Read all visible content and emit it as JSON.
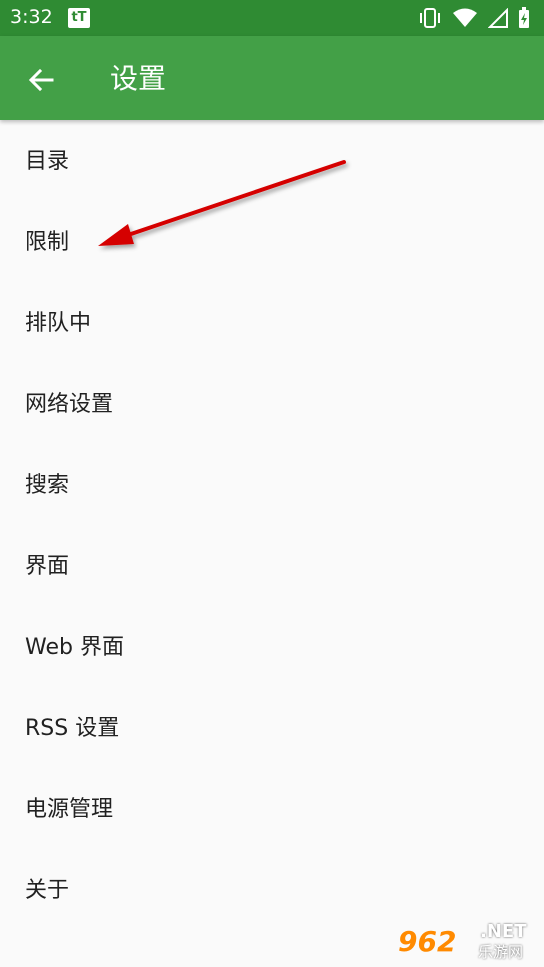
{
  "status_bar": {
    "time": "3:32",
    "notification_icon_text": "tT",
    "icons": [
      "vibrate-icon",
      "wifi-icon",
      "cellular-icon",
      "battery-charging-icon"
    ]
  },
  "app_bar": {
    "back_icon": "arrow-back-icon",
    "title": "设置"
  },
  "menu": [
    {
      "label": "目录"
    },
    {
      "label": "限制"
    },
    {
      "label": "排队中"
    },
    {
      "label": "网络设置"
    },
    {
      "label": "搜索"
    },
    {
      "label": "界面"
    },
    {
      "label": "Web 界面"
    },
    {
      "label": "RSS 设置"
    },
    {
      "label": "电源管理"
    },
    {
      "label": "关于"
    }
  ],
  "annotation": {
    "type": "red-arrow",
    "points_to": "限制"
  },
  "watermark": {
    "logo": "962",
    "net": ".NET",
    "sub": "乐游网"
  },
  "colors": {
    "status_bar": "#2f8b33",
    "app_bar": "#43a047",
    "background": "#fafafa",
    "text": "#212121",
    "arrow": "#d50000"
  }
}
